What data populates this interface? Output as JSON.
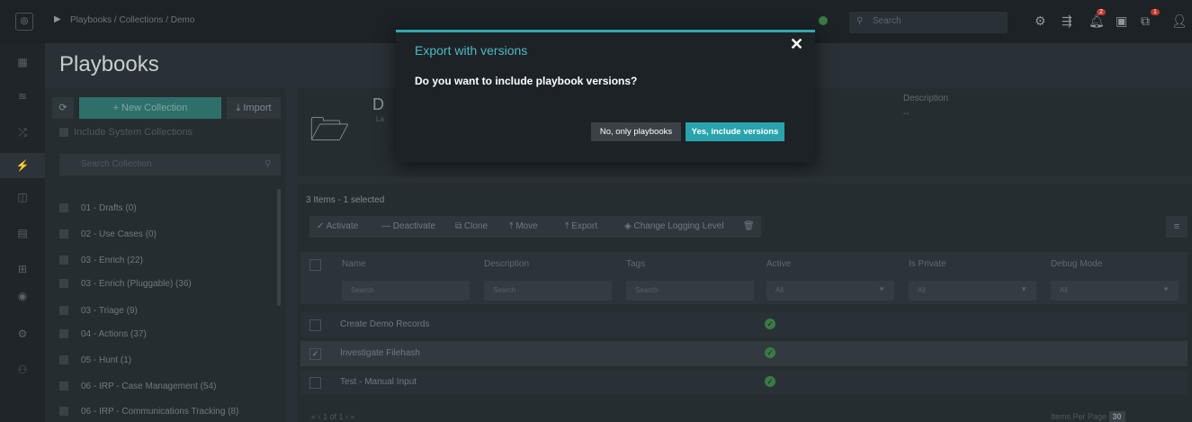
{
  "topbar": {
    "breadcrumb": "Playbooks / Collections / Demo",
    "search_placeholder": "Search",
    "notif_badge": "2",
    "queue_badge": "1"
  },
  "page": {
    "title": "Playbooks"
  },
  "collections": {
    "new_button": "+ New Collection",
    "import_button": "Import",
    "include_system": "Include System Collections",
    "search_placeholder": "Search Collection",
    "items": [
      "01 - Drafts (0)",
      "02 - Use Cases (0)",
      "03 - Enrich (22)",
      "03 - Enrich (Pluggable) (36)",
      "03 - Triage (9)",
      "04 - Actions (37)",
      "05 - Hunt (1)",
      "06 - IRP - Case Management (54)",
      "06 - IRP - Communications Tracking (8)"
    ]
  },
  "detail": {
    "initial": "D",
    "la": "La",
    "description_label": "Description",
    "description_value": "--"
  },
  "grid": {
    "items_count": "3 Items - 1 selected",
    "toolbar": {
      "activate": "Activate",
      "deactivate": "Deactivate",
      "clone": "Clone",
      "move": "Move",
      "export": "Export",
      "logging": "Change Logging Level"
    },
    "columns": [
      "Name",
      "Description",
      "Tags",
      "Active",
      "Is Private",
      "Debug Mode"
    ],
    "filters": {
      "name": "Search",
      "description": "Search",
      "tags": "Search",
      "active": "All",
      "private": "All",
      "debug": "All"
    },
    "rows": [
      {
        "name": "Create Demo Records",
        "active": true,
        "selected": false
      },
      {
        "name": "Investigate Filehash",
        "active": true,
        "selected": true
      },
      {
        "name": "Test - Manual Input",
        "active": true,
        "selected": false
      }
    ],
    "pager": "1 of 1",
    "per_page_label": "Items Per Page",
    "per_page_value": "30"
  },
  "modal": {
    "title": "Export with versions",
    "body": "Do you want to include playbook versions?",
    "no_button": "No, only playbooks",
    "yes_button": "Yes, include versions"
  },
  "colors": {
    "accent": "#2aa3ad",
    "modal_bg": "#1c2226",
    "success": "#3a7a45"
  }
}
